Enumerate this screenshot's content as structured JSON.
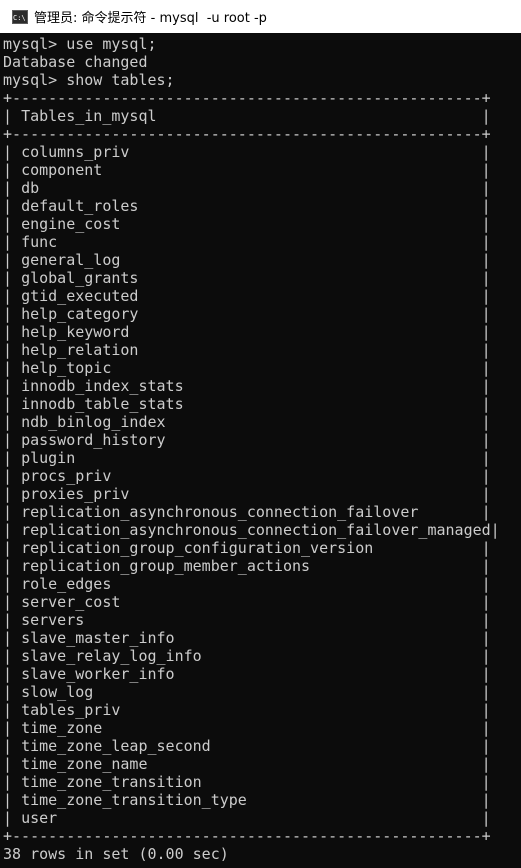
{
  "window": {
    "title": "管理员: 命令提示符 - mysql  -u root -p",
    "icon": "cmd-icon",
    "icon_text": "C:\\."
  },
  "console": {
    "commands": [
      "mysql> use mysql;",
      "Database changed",
      "mysql> show tables;"
    ],
    "table": {
      "header": "Tables_in_mysql",
      "rows": [
        "columns_priv",
        "component",
        "db",
        "default_roles",
        "engine_cost",
        "func",
        "general_log",
        "global_grants",
        "gtid_executed",
        "help_category",
        "help_keyword",
        "help_relation",
        "help_topic",
        "innodb_index_stats",
        "innodb_table_stats",
        "ndb_binlog_index",
        "password_history",
        "plugin",
        "procs_priv",
        "proxies_priv",
        "replication_asynchronous_connection_failover",
        "replication_asynchronous_connection_failover_managed",
        "replication_group_configuration_version",
        "replication_group_member_actions",
        "role_edges",
        "server_cost",
        "servers",
        "slave_master_info",
        "slave_relay_log_info",
        "slave_worker_info",
        "slow_log",
        "tables_priv",
        "time_zone",
        "time_zone_leap_second",
        "time_zone_name",
        "time_zone_transition",
        "time_zone_transition_type",
        "user"
      ]
    },
    "summary": "38 rows in set (0.00 sec)"
  },
  "colors": {
    "background": "#0c0c0c",
    "text": "#cccccc",
    "titlebar": "#ffffff"
  }
}
